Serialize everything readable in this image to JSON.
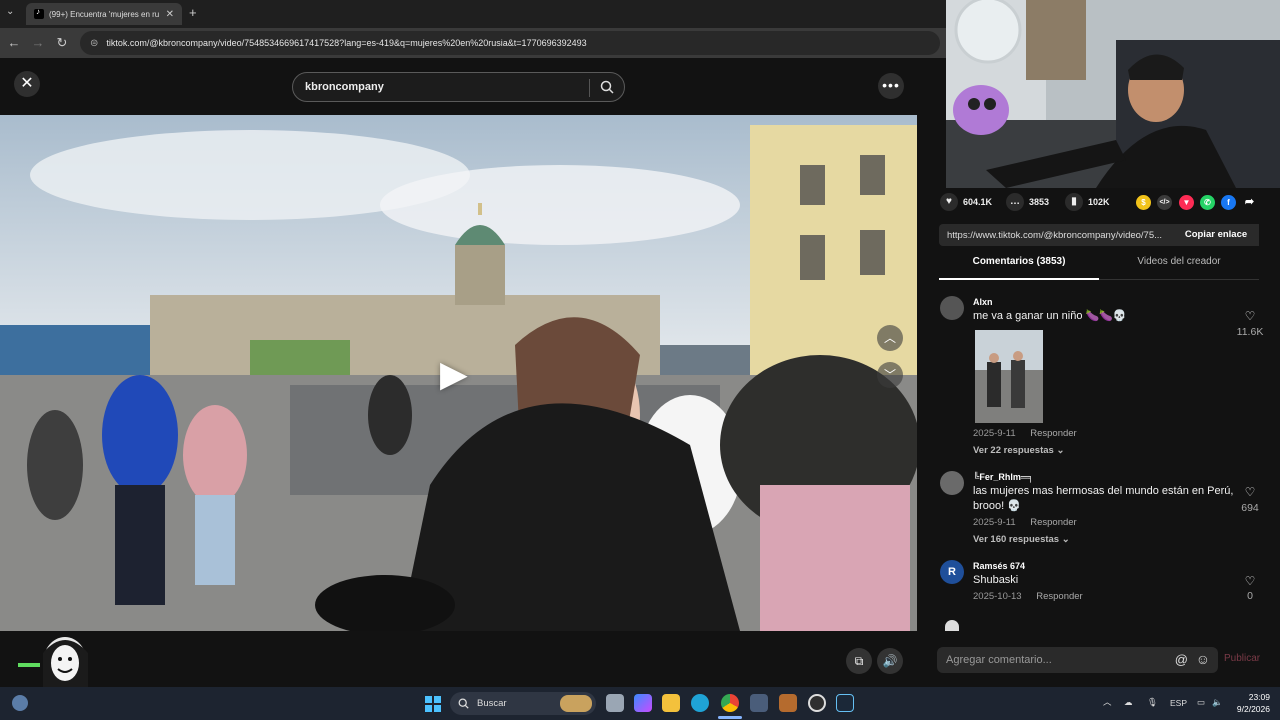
{
  "browser": {
    "tab_title": "(99+) Encuentra 'mujeres en ru",
    "tab_close": "✕",
    "new_tab": "+",
    "tab_menu": "⌄",
    "nav_back": "←",
    "nav_forward": "→",
    "nav_reload": "↻",
    "url": "tiktok.com/@kbroncompany/video/7548534669617417528?lang=es-419&q=mujeres%20en%20rusia&t=1770696392493"
  },
  "player": {
    "close": "✕",
    "search_value": "kbroncompany",
    "more": "•••",
    "play": "▶",
    "nav_up": "︿",
    "nav_down": "﹀",
    "pip": "⧉",
    "volume": "🔊"
  },
  "stats": {
    "likes": "604.1K",
    "comments": "3853",
    "saves": "102K"
  },
  "link": {
    "url": "https://www.tiktok.com/@kbroncompany/video/75...",
    "copy_label": "Copiar enlace"
  },
  "tabs": {
    "comments": "Comentarios (3853)",
    "creator": "Videos del creador"
  },
  "comments": [
    {
      "user": "Alxn",
      "text": "me va a ganar un niño 🍆🍆💀",
      "date": "2025-9-11",
      "reply": "Responder",
      "replies": "Ver 22 respuestas ⌄",
      "likes": "11.6K"
    },
    {
      "user": "╚Fer_Rhlm═╕",
      "text": "las mujeres mas hermosas del mundo están en Perú, brooo! 💀",
      "date": "2025-9-11",
      "reply": "Responder",
      "replies": "Ver 160 respuestas ⌄",
      "likes": "694"
    },
    {
      "user": "Ramsés 674",
      "avatar_letter": "R",
      "text": "Shubaski",
      "date": "2025-10-13",
      "reply": "Responder",
      "likes": "0"
    }
  ],
  "comment_input": {
    "placeholder": "Agregar comentario...",
    "mention": "@",
    "emoji": "☺",
    "publish": "Publicar"
  },
  "taskbar": {
    "search_label": "Buscar",
    "language": "ESP",
    "time": "23:09",
    "date": "9/2/2026",
    "chevron": "︿"
  },
  "colors": {
    "accent_pink": "#fe2c55",
    "panel_bg": "#121212",
    "taskbar_bg": "#1d2430"
  }
}
